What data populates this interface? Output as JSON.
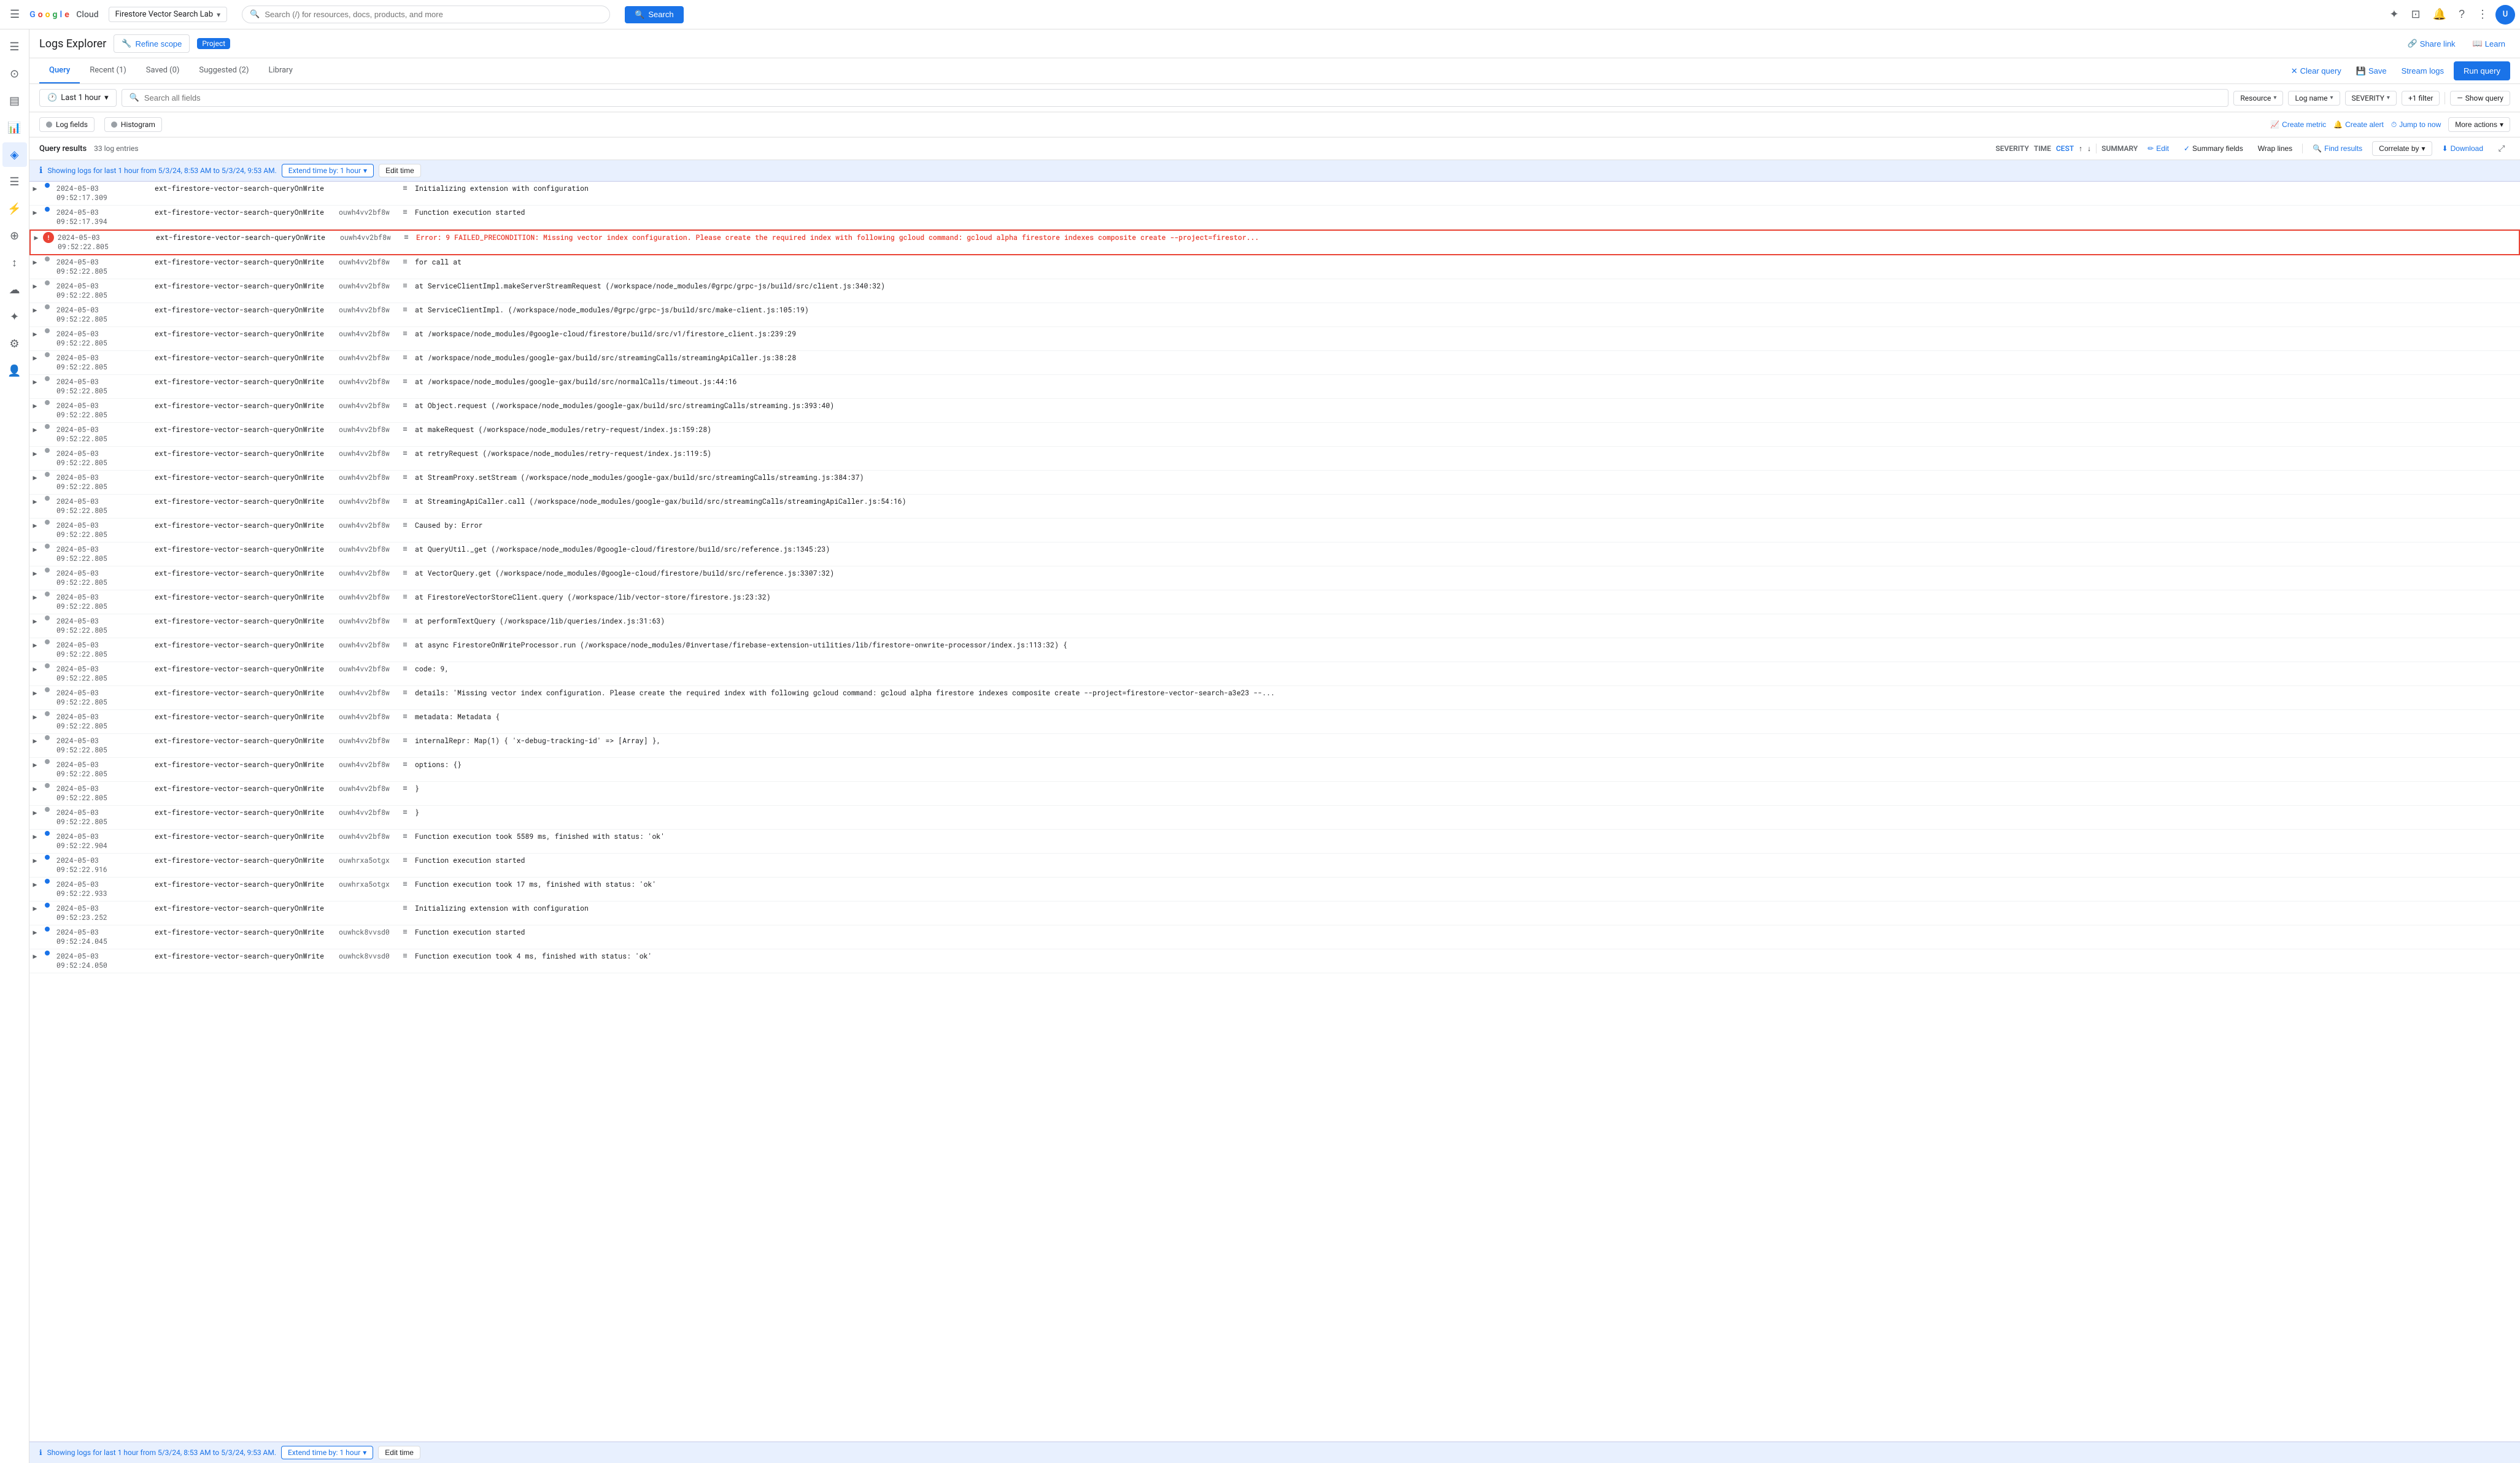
{
  "topNav": {
    "hamburgerLabel": "☰",
    "logoText": "Google Cloud",
    "projectName": "Firestore Vector Search Lab",
    "searchPlaceholder": "Search (/) for resources, docs, products, and more",
    "searchBtnLabel": "Search",
    "navIcons": [
      "✦",
      "⊡",
      "🔔",
      "?",
      "⋮"
    ],
    "avatarInitial": "U"
  },
  "sidebar": {
    "icons": [
      "☰",
      "⊙",
      "▤",
      "📊",
      "◈",
      "☰",
      "⚡",
      "⊕",
      "↕",
      "☁",
      "✦",
      "⚙",
      "👤"
    ]
  },
  "logsExplorer": {
    "title": "Logs Explorer",
    "refineScopeLabel": "Refine scope",
    "projectBadge": "Project",
    "shareLinkLabel": "Share link",
    "learnLabel": "Learn"
  },
  "tabs": {
    "items": [
      {
        "label": "Query",
        "active": true
      },
      {
        "label": "Recent (1)",
        "active": false
      },
      {
        "label": "Saved (0)",
        "active": false
      },
      {
        "label": "Suggested (2)",
        "active": false
      },
      {
        "label": "Library",
        "active": false
      }
    ],
    "clearQueryLabel": "Clear query",
    "saveLabel": "Save",
    "streamLogsLabel": "Stream logs",
    "runQueryLabel": "Run query"
  },
  "queryBar": {
    "timeFilterLabel": "Last 1 hour",
    "searchPlaceholder": "Search all fields",
    "filters": [
      {
        "label": "Resource",
        "hasDropdown": true
      },
      {
        "label": "Log name",
        "hasDropdown": true
      },
      {
        "label": "Severity",
        "hasDropdown": true
      },
      {
        "label": "+1 filter",
        "hasBadge": false
      },
      {
        "label": "—"
      },
      {
        "label": "Show query"
      }
    ]
  },
  "viewToggles": {
    "logFieldsLabel": "Log fields",
    "histogramLabel": "Histogram",
    "createMetricLabel": "Create metric",
    "createAlertLabel": "Create alert",
    "jumpToNowLabel": "Jump to now",
    "moreActionsLabel": "More actions"
  },
  "resultsHeader": {
    "queryResultsLabel": "Query results",
    "countLabel": "33 log entries",
    "severityLabel": "SEVERITY",
    "timeLabel": "TIME",
    "timezoneLabel": "CEST",
    "summaryLabel": "SUMMARY",
    "editLabel": "Edit",
    "summaryFieldsLabel": "Summary fields",
    "wrapLinesLabel": "Wrap lines",
    "findResultsLabel": "Find results",
    "correlateByLabel": "Correlate by",
    "downloadLabel": "Download",
    "expandLabel": "⤢"
  },
  "infoBar": {
    "message": "Showing logs for last 1 hour from 5/3/24, 8:53 AM to 5/3/24, 9:53 AM.",
    "extendLabel": "Extend time by: 1 hour",
    "editTimeLabel": "Edit time"
  },
  "logRows": [
    {
      "sev": "info",
      "time": "2024-05-03  09:52:17.309",
      "logName": "ext-firestore-vector-search-queryOnWrite",
      "instance": "",
      "icon": "≡",
      "message": "Initializing extension with configuration"
    },
    {
      "sev": "info",
      "time": "2024-05-03  09:52:17.394",
      "logName": "ext-firestore-vector-search-queryOnWrite",
      "instance": "ouwh4vv2bf8w",
      "icon": "≡",
      "message": "Function execution started"
    },
    {
      "sev": "error",
      "time": "2024-05-03  09:52:22.805",
      "logName": "ext-firestore-vector-search-queryOnWrite",
      "instance": "ouwh4vv2bf8w",
      "icon": "≡",
      "message": "Error: 9 FAILED_PRECONDITION: Missing vector index configuration. Please create the required index with following gcloud command: gcloud alpha firestore indexes composite create --project=firestor...",
      "highlighted": true
    },
    {
      "sev": "debug",
      "time": "2024-05-03  09:52:22.805",
      "logName": "ext-firestore-vector-search-queryOnWrite",
      "instance": "ouwh4vv2bf8w",
      "icon": "≡",
      "message": "for call at"
    },
    {
      "sev": "debug",
      "time": "2024-05-03  09:52:22.805",
      "logName": "ext-firestore-vector-search-queryOnWrite",
      "instance": "ouwh4vv2bf8w",
      "icon": "≡",
      "message": "at ServiceClientImpl.makeServerStreamRequest (/workspace/node_modules/@grpc/grpc-js/build/src/client.js:340:32)"
    },
    {
      "sev": "debug",
      "time": "2024-05-03  09:52:22.805",
      "logName": "ext-firestore-vector-search-queryOnWrite",
      "instance": "ouwh4vv2bf8w",
      "icon": "≡",
      "message": "at ServiceClientImpl.<anonymous> (/workspace/node_modules/@grpc/grpc-js/build/src/make-client.js:105:19)"
    },
    {
      "sev": "debug",
      "time": "2024-05-03  09:52:22.805",
      "logName": "ext-firestore-vector-search-queryOnWrite",
      "instance": "ouwh4vv2bf8w",
      "icon": "≡",
      "message": "at /workspace/node_modules/@google-cloud/firestore/build/src/v1/firestore_client.js:239:29"
    },
    {
      "sev": "debug",
      "time": "2024-05-03  09:52:22.805",
      "logName": "ext-firestore-vector-search-queryOnWrite",
      "instance": "ouwh4vv2bf8w",
      "icon": "≡",
      "message": "at /workspace/node_modules/google-gax/build/src/streamingCalls/streamingApiCaller.js:38:28"
    },
    {
      "sev": "debug",
      "time": "2024-05-03  09:52:22.805",
      "logName": "ext-firestore-vector-search-queryOnWrite",
      "instance": "ouwh4vv2bf8w",
      "icon": "≡",
      "message": "at /workspace/node_modules/google-gax/build/src/normalCalls/timeout.js:44:16"
    },
    {
      "sev": "debug",
      "time": "2024-05-03  09:52:22.805",
      "logName": "ext-firestore-vector-search-queryOnWrite",
      "instance": "ouwh4vv2bf8w",
      "icon": "≡",
      "message": "at Object.request (/workspace/node_modules/google-gax/build/src/streamingCalls/streaming.js:393:40)"
    },
    {
      "sev": "debug",
      "time": "2024-05-03  09:52:22.805",
      "logName": "ext-firestore-vector-search-queryOnWrite",
      "instance": "ouwh4vv2bf8w",
      "icon": "≡",
      "message": "at makeRequest (/workspace/node_modules/retry-request/index.js:159:28)"
    },
    {
      "sev": "debug",
      "time": "2024-05-03  09:52:22.805",
      "logName": "ext-firestore-vector-search-queryOnWrite",
      "instance": "ouwh4vv2bf8w",
      "icon": "≡",
      "message": "at retryRequest (/workspace/node_modules/retry-request/index.js:119:5)"
    },
    {
      "sev": "debug",
      "time": "2024-05-03  09:52:22.805",
      "logName": "ext-firestore-vector-search-queryOnWrite",
      "instance": "ouwh4vv2bf8w",
      "icon": "≡",
      "message": "at StreamProxy.setStream (/workspace/node_modules/google-gax/build/src/streamingCalls/streaming.js:384:37)"
    },
    {
      "sev": "debug",
      "time": "2024-05-03  09:52:22.805",
      "logName": "ext-firestore-vector-search-queryOnWrite",
      "instance": "ouwh4vv2bf8w",
      "icon": "≡",
      "message": "at StreamingApiCaller.call (/workspace/node_modules/google-gax/build/src/streamingCalls/streamingApiCaller.js:54:16)"
    },
    {
      "sev": "debug",
      "time": "2024-05-03  09:52:22.805",
      "logName": "ext-firestore-vector-search-queryOnWrite",
      "instance": "ouwh4vv2bf8w",
      "icon": "≡",
      "message": "Caused by: Error"
    },
    {
      "sev": "debug",
      "time": "2024-05-03  09:52:22.805",
      "logName": "ext-firestore-vector-search-queryOnWrite",
      "instance": "ouwh4vv2bf8w",
      "icon": "≡",
      "message": "at QueryUtil._get (/workspace/node_modules/@google-cloud/firestore/build/src/reference.js:1345:23)"
    },
    {
      "sev": "debug",
      "time": "2024-05-03  09:52:22.805",
      "logName": "ext-firestore-vector-search-queryOnWrite",
      "instance": "ouwh4vv2bf8w",
      "icon": "≡",
      "message": "at VectorQuery.get (/workspace/node_modules/@google-cloud/firestore/build/src/reference.js:3307:32)"
    },
    {
      "sev": "debug",
      "time": "2024-05-03  09:52:22.805",
      "logName": "ext-firestore-vector-search-queryOnWrite",
      "instance": "ouwh4vv2bf8w",
      "icon": "≡",
      "message": "at FirestoreVectorStoreClient.query (/workspace/lib/vector-store/firestore.js:23:32)"
    },
    {
      "sev": "debug",
      "time": "2024-05-03  09:52:22.805",
      "logName": "ext-firestore-vector-search-queryOnWrite",
      "instance": "ouwh4vv2bf8w",
      "icon": "≡",
      "message": "at performTextQuery (/workspace/lib/queries/index.js:31:63)"
    },
    {
      "sev": "debug",
      "time": "2024-05-03  09:52:22.805",
      "logName": "ext-firestore-vector-search-queryOnWrite",
      "instance": "ouwh4vv2bf8w",
      "icon": "≡",
      "message": "at async FirestoreOnWriteProcessor.run (/workspace/node_modules/@invertase/firebase-extension-utilities/lib/firestore-onwrite-processor/index.js:113:32) {"
    },
    {
      "sev": "debug",
      "time": "2024-05-03  09:52:22.805",
      "logName": "ext-firestore-vector-search-queryOnWrite",
      "instance": "ouwh4vv2bf8w",
      "icon": "≡",
      "message": "code: 9,"
    },
    {
      "sev": "debug",
      "time": "2024-05-03  09:52:22.805",
      "logName": "ext-firestore-vector-search-queryOnWrite",
      "instance": "ouwh4vv2bf8w",
      "icon": "≡",
      "message": "details: 'Missing vector index configuration. Please create the required index with following gcloud command: gcloud alpha firestore indexes composite create --project=firestore-vector-search-a3e23 --..."
    },
    {
      "sev": "debug",
      "time": "2024-05-03  09:52:22.805",
      "logName": "ext-firestore-vector-search-queryOnWrite",
      "instance": "ouwh4vv2bf8w",
      "icon": "≡",
      "message": "metadata: Metadata {"
    },
    {
      "sev": "debug",
      "time": "2024-05-03  09:52:22.805",
      "logName": "ext-firestore-vector-search-queryOnWrite",
      "instance": "ouwh4vv2bf8w",
      "icon": "≡",
      "message": "    internalRepr: Map(1) { 'x-debug-tracking-id' => [Array] },"
    },
    {
      "sev": "debug",
      "time": "2024-05-03  09:52:22.805",
      "logName": "ext-firestore-vector-search-queryOnWrite",
      "instance": "ouwh4vv2bf8w",
      "icon": "≡",
      "message": "    options: {}"
    },
    {
      "sev": "debug",
      "time": "2024-05-03  09:52:22.805",
      "logName": "ext-firestore-vector-search-queryOnWrite",
      "instance": "ouwh4vv2bf8w",
      "icon": "≡",
      "message": "}"
    },
    {
      "sev": "debug",
      "time": "2024-05-03  09:52:22.805",
      "logName": "ext-firestore-vector-search-queryOnWrite",
      "instance": "ouwh4vv2bf8w",
      "icon": "≡",
      "message": "}"
    },
    {
      "sev": "info",
      "time": "2024-05-03  09:52:22.904",
      "logName": "ext-firestore-vector-search-queryOnWrite",
      "instance": "ouwh4vv2bf8w",
      "icon": "≡",
      "message": "Function execution took 5589 ms, finished with status: 'ok'"
    },
    {
      "sev": "info",
      "time": "2024-05-03  09:52:22.916",
      "logName": "ext-firestore-vector-search-queryOnWrite",
      "instance": "ouwhrxa5otgx",
      "icon": "≡",
      "message": "Function execution started"
    },
    {
      "sev": "info",
      "time": "2024-05-03  09:52:22.933",
      "logName": "ext-firestore-vector-search-queryOnWrite",
      "instance": "ouwhrxa5otgx",
      "icon": "≡",
      "message": "Function execution took 17 ms, finished with status: 'ok'"
    },
    {
      "sev": "info",
      "time": "2024-05-03  09:52:23.252",
      "logName": "ext-firestore-vector-search-queryOnWrite",
      "instance": "",
      "icon": "≡",
      "message": "Initializing extension with configuration"
    },
    {
      "sev": "info",
      "time": "2024-05-03  09:52:24.045",
      "logName": "ext-firestore-vector-search-queryOnWrite",
      "instance": "ouwhck8vvsd0",
      "icon": "≡",
      "message": "Function execution started"
    },
    {
      "sev": "info",
      "time": "2024-05-03  09:52:24.050",
      "logName": "ext-firestore-vector-search-queryOnWrite",
      "instance": "ouwhck8vvsd0",
      "icon": "≡",
      "message": "Function execution took 4 ms, finished with status: 'ok'"
    }
  ],
  "bottomInfoBar": {
    "message": "Showing logs for last 1 hour from 5/3/24, 8:53 AM to 5/3/24, 9:53 AM.",
    "extendLabel": "Extend time by: 1 hour",
    "editTimeLabel": "Edit time"
  }
}
